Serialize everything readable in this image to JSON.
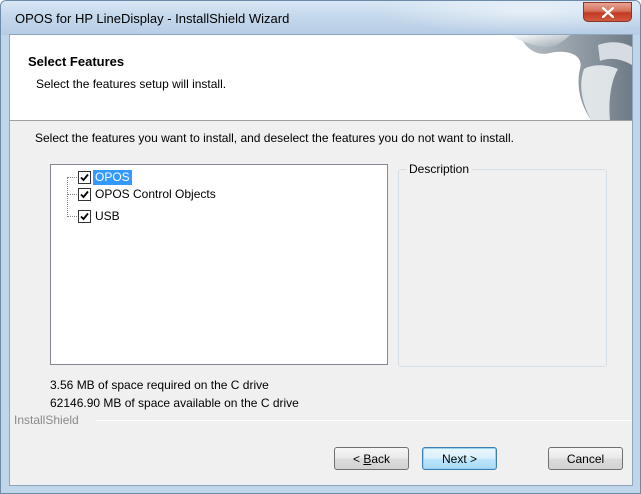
{
  "window": {
    "title": "OPOS for HP LineDisplay - InstallShield Wizard"
  },
  "header": {
    "title": "Select Features",
    "subtitle": "Select the features setup will install."
  },
  "instruction": "Select the features you want to install, and deselect the features you do not want to install.",
  "features": [
    {
      "label": "OPOS",
      "checked": true,
      "selected": true
    },
    {
      "label": "OPOS Control Objects",
      "checked": true,
      "selected": false
    },
    {
      "label": "USB",
      "checked": true,
      "selected": false
    }
  ],
  "description": {
    "legend": "Description",
    "text": ""
  },
  "space": {
    "required": "3.56 MB of space required on the C drive",
    "available": "62146.90 MB of space available on the C drive"
  },
  "brand": "InstallShield",
  "buttons": {
    "back_prefix": "< ",
    "back_mnemonic": "B",
    "back_rest": "ack",
    "next": "Next >",
    "cancel": "Cancel"
  }
}
